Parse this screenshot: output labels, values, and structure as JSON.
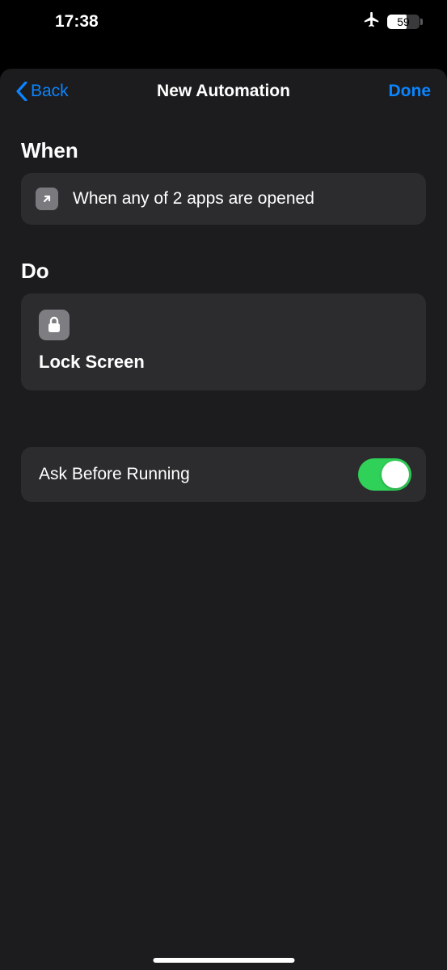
{
  "status_bar": {
    "time": "17:38",
    "battery_percent": "59"
  },
  "nav": {
    "back_label": "Back",
    "title": "New Automation",
    "done_label": "Done"
  },
  "sections": {
    "when_heading": "When",
    "when_text": "When any of 2 apps are opened",
    "do_heading": "Do",
    "do_action": "Lock Screen"
  },
  "settings": {
    "ask_before_label": "Ask Before Running",
    "ask_before_on": true
  }
}
